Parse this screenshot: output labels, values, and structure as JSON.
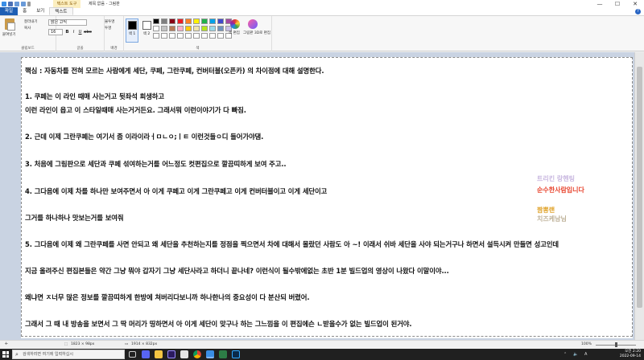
{
  "titlebar": {
    "context_tab": "텍스트 도구",
    "title": "제목 없음 - 그림판",
    "minimize": "—",
    "maximize": "☐",
    "close": "✕"
  },
  "tabs": [
    "파일",
    "홈",
    "보기",
    "텍스트"
  ],
  "ribbon": {
    "paste_label": "붙여넣기",
    "cut": "잘라내기",
    "copy": "복사",
    "clipboard_group": "클립보드",
    "font_name": "맑은 고딕",
    "font_size": "16",
    "font_group": "글꼴",
    "opaque": "불투명",
    "transparent": "투명",
    "background_group": "배경",
    "color1_label": "색 1",
    "color2_label": "색 2",
    "edit_colors_label": "색 편집",
    "paint3d_label": "그림판 3D로 편집",
    "colors_group": "색",
    "palette": [
      "#000000",
      "#7f7f7f",
      "#880015",
      "#ed1c24",
      "#ff7f27",
      "#fff200",
      "#22b14c",
      "#00a2e8",
      "#3f48cc",
      "#a349a4",
      "#ffffff",
      "#c3c3c3",
      "#b97a57",
      "#ffaec9",
      "#ffc90e",
      "#efe4b0",
      "#b5e61d",
      "#99d9ea",
      "#7092be",
      "#c8bfe7",
      "#ffffff",
      "#ffffff",
      "#ffffff",
      "#ffffff",
      "#ffffff",
      "#ffffff",
      "#ffffff",
      "#ffffff",
      "#ffffff",
      "#ffffff"
    ]
  },
  "document": {
    "lines": [
      "핵심 : 자동차를 전혀 모르는 사람에게 세단, 쿠페, 그란쿠페, 컨버터블(오픈카) 의 차이점에 대해 설명한다.",
      "1. 쿠페는 이 라인 때매 사는거고 뒷좌석 희생하고",
      "  이런 라인이 읍고 이 스타일때매 사는거거든요. 그래서뭐 이런이야기가 다 빠짐.",
      "2. 근데 이제 그란쿠페는 여기서 좀 이라이라ㅓㅁㄴㅇ;ㅣㅌ 이런것들ㅇ디 들어가야댐.",
      "3. 처음에 그림판으로 세단과 쿠페 섞여하는거를 어느정도 컷편집으로 깔끔띠하게 보여 주고..",
      "4. 그다음에 이제 차를 하나만 보여주면서 아 이게 쿠페고 이게 그란쿠페고 이게 컨버터블이고 이게 세단이고",
      "그거를 하나하나 맛보는거를 보여줘",
      "5. 그다음에 이제 왜 그란쿠페를 사면 안되고 왜 세단을 추천하는지를 정점을 찍으면서 차에 대해서 몰랐던 사람도 아 ~! 이래서 쉬바 세단을 사야 되는거구나 하면서 설득시켜 만들면 성고인데",
      "지금 올려주신 편집본들은 약간 그냥 뭐야 갑자기 그냥 세단사라고 하더니 끝나네? 이런식이 될수밖에없는 초반 1분 빌드업의 영상이 나왔다 이말이야...",
      "왜냐면 ㅈ너무 많은 정보를 깔끔띠하게 한방에 쳐버리다보니까 하나한나의 중요성이 다 분산되 버렸어.",
      "그래서 그 때 내 방송을 보면서 그 딱 머리가 띵하면서 아 이게 세단이 맞구나 하는 그느낌을 이 편집에슨 ㄴ받을수가 없는 빌드업이 된거야."
    ]
  },
  "overlay": {
    "line1": "트리킨 랑헨팅",
    "line2": "순수한사람입니다",
    "line3": "짬뽕랜",
    "line4": "치즈케남님"
  },
  "statusbar": {
    "selection_size": "1823 × 98px",
    "canvas_size": "1914 × 832px",
    "zoom": "100%"
  },
  "taskbar": {
    "search_placeholder": "검색하려면 여기에 입력하십시",
    "time": "오전 2:20",
    "date": "2022-09-14"
  }
}
